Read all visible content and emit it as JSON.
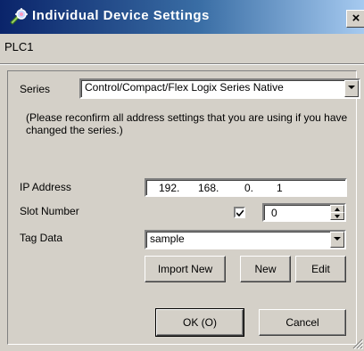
{
  "window": {
    "title": "Individual Device Settings",
    "close_label": "×"
  },
  "device_name": "PLC1",
  "series": {
    "label": "Series",
    "value": "Control/Compact/Flex Logix Series Native"
  },
  "note": "(Please reconfirm all address settings that you are using if you have changed the series.)",
  "ip_address": {
    "label": "IP Address",
    "octets": [
      "192.",
      "168.",
      "0.",
      "1"
    ]
  },
  "slot_number": {
    "label": "Slot Number",
    "checked": true,
    "value": "0"
  },
  "tag_data": {
    "label": "Tag Data",
    "value": "sample"
  },
  "buttons": {
    "import_new": "Import New",
    "new": "New",
    "edit": "Edit",
    "ok": "OK (O)",
    "cancel": "Cancel"
  },
  "icons": [
    "device-settings-icon",
    "close-icon",
    "dropdown-arrow-icon",
    "checkmark-icon",
    "spin-up-icon",
    "spin-down-icon",
    "size-grip-icon"
  ]
}
